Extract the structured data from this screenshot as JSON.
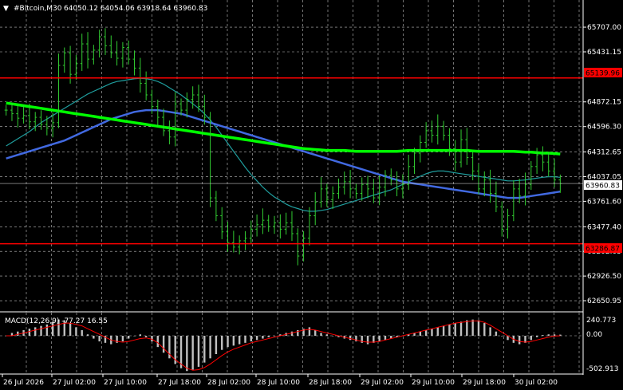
{
  "header": {
    "symbol": "#Bitcoin,M30",
    "ohlc": "64050.12 64054.06 63918.64 63960.83"
  },
  "price_axis": {
    "ticks": [
      "65707.00",
      "65431.15",
      "64872.15",
      "64596.30",
      "64312.65",
      "64037.05",
      "63761.60",
      "63477.40",
      "63202.05",
      "62926.50",
      "62650.95"
    ]
  },
  "levels": {
    "resistance": "65139.96",
    "support": "63286.87",
    "current": "63960.83"
  },
  "macd": {
    "label": "MACD(12,26,9) -77.27 16.55",
    "ticks": [
      "240.773",
      "0.00",
      "-502.913"
    ]
  },
  "time_axis": {
    "labels": [
      "26 Jul 2026",
      "27 Jul 02:00",
      "27 Jul 10:00",
      "27 Jul 18:00",
      "28 Jul 02:00",
      "28 Jul 10:00",
      "28 Jul 18:00",
      "29 Jul 02:00",
      "29 Jul 10:00",
      "29 Jul 18:00",
      "30 Jul 02:00"
    ]
  },
  "colors": {
    "background": "#000000",
    "grid": "#c0c0c0",
    "candles": "#32cd32",
    "ma_fast": "#1f9e9e",
    "ma_mid": "#4169e1",
    "ma_slow": "#00ff00",
    "levels": "#ff0000",
    "macd_hist": "#c0c0c0",
    "macd_signal": "#ff0000"
  },
  "chart_data": {
    "type": "candlestick",
    "symbol": "#Bitcoin",
    "timeframe": "M30",
    "ylim": [
      62580,
      65850
    ],
    "macd_ylim": [
      -520,
      260
    ],
    "grid": true,
    "close": [
      64780,
      64740,
      64690,
      64720,
      64650,
      64700,
      64620,
      64580,
      64640,
      65280,
      65420,
      65180,
      65300,
      65520,
      65350,
      65450,
      65600,
      65500,
      65420,
      65360,
      65480,
      65350,
      65250,
      65080,
      64950,
      64820,
      64700,
      64550,
      64480,
      64850,
      64780,
      64900,
      64950,
      64820,
      64700,
      63800,
      63600,
      63420,
      63300,
      63250,
      63320,
      63350,
      63450,
      63500,
      63550,
      63480,
      63520,
      63450,
      63520,
      63400,
      63150,
      63350,
      63600,
      63750,
      63900,
      63780,
      63850,
      63920,
      63980,
      63900,
      63850,
      63950,
      63900,
      63800,
      63920,
      64050,
      64000,
      63900,
      63950,
      64150,
      64300,
      64420,
      64550,
      64500,
      64600,
      64500,
      64350,
      64200,
      64450,
      64250,
      64100,
      63900,
      64000,
      63850,
      63700,
      63450,
      63600,
      63900,
      63820,
      63950,
      64150,
      64280,
      64200,
      64100,
      64000,
      63960
    ],
    "ma_fast": [
      64380,
      64420,
      64460,
      64500,
      64540,
      64590,
      64640,
      64680,
      64720,
      64760,
      64800,
      64840,
      64880,
      64920,
      64960,
      64990,
      65020,
      65050,
      65080,
      65100,
      65110,
      65120,
      65130,
      65135,
      65130,
      65120,
      65100,
      65070,
      65030,
      64990,
      64950,
      64900,
      64850,
      64800,
      64740,
      64670,
      64590,
      64500,
      64410,
      64320,
      64230,
      64140,
      64060,
      63990,
      63920,
      63860,
      63810,
      63770,
      63730,
      63700,
      63680,
      63660,
      63650,
      63650,
      63660,
      63670,
      63690,
      63710,
      63730,
      63750,
      63770,
      63790,
      63810,
      63830,
      63850,
      63870,
      63890,
      63920,
      63950,
      63980,
      64010,
      64040,
      64070,
      64090,
      64100,
      64100,
      64090,
      64080,
      64070,
      64060,
      64050,
      64040,
      64030,
      64020,
      64010,
      64000,
      63990,
      63990,
      63995,
      64000,
      64010,
      64020,
      64030,
      64035,
      64035,
      64030
    ],
    "ma_mid": [
      64240,
      64260,
      64280,
      64300,
      64320,
      64340,
      64360,
      64380,
      64400,
      64420,
      64440,
      64470,
      64500,
      64530,
      64560,
      64590,
      64620,
      64650,
      64680,
      64700,
      64720,
      64740,
      64760,
      64770,
      64780,
      64780,
      64780,
      64770,
      64760,
      64750,
      64740,
      64720,
      64700,
      64680,
      64660,
      64640,
      64620,
      64600,
      64580,
      64560,
      64540,
      64520,
      64500,
      64480,
      64460,
      64440,
      64420,
      64400,
      64380,
      64360,
      64340,
      64320,
      64300,
      64280,
      64260,
      64240,
      64220,
      64200,
      64180,
      64160,
      64140,
      64120,
      64100,
      64080,
      64060,
      64040,
      64020,
      64000,
      63980,
      63970,
      63960,
      63950,
      63940,
      63930,
      63920,
      63910,
      63900,
      63890,
      63880,
      63870,
      63860,
      63850,
      63840,
      63830,
      63820,
      63810,
      63800,
      63800,
      63800,
      63810,
      63820,
      63830,
      63840,
      63850,
      63860,
      63870
    ],
    "ma_slow": [
      64860,
      64850,
      64840,
      64830,
      64820,
      64810,
      64800,
      64790,
      64780,
      64770,
      64760,
      64750,
      64740,
      64730,
      64720,
      64710,
      64700,
      64690,
      64680,
      64670,
      64660,
      64650,
      64640,
      64630,
      64620,
      64610,
      64600,
      64590,
      64580,
      64570,
      64560,
      64550,
      64540,
      64530,
      64520,
      64510,
      64500,
      64490,
      64480,
      64470,
      64460,
      64450,
      64440,
      64430,
      64420,
      64410,
      64400,
      64390,
      64380,
      64370,
      64360,
      64350,
      64345,
      64340,
      64335,
      64330,
      64330,
      64330,
      64330,
      64325,
      64320,
      64320,
      64320,
      64320,
      64320,
      64320,
      64320,
      64320,
      64325,
      64330,
      64330,
      64330,
      64330,
      64330,
      64330,
      64330,
      64330,
      64330,
      64330,
      64330,
      64325,
      64320,
      64320,
      64320,
      64320,
      64320,
      64320,
      64320,
      64315,
      64310,
      64310,
      64305,
      64300,
      64300,
      64295,
      64290
    ],
    "macd_hist": [
      0,
      40,
      60,
      80,
      100,
      120,
      140,
      160,
      200,
      230,
      220,
      180,
      120,
      80,
      20,
      -40,
      -80,
      -100,
      -120,
      -100,
      -80,
      -40,
      0,
      20,
      -20,
      -80,
      -160,
      -240,
      -320,
      -400,
      -460,
      -500,
      -480,
      -440,
      -380,
      -320,
      -260,
      -200,
      -160,
      -140,
      -120,
      -100,
      -80,
      -60,
      -40,
      -20,
      0,
      20,
      40,
      60,
      80,
      100,
      120,
      80,
      40,
      20,
      0,
      -20,
      -40,
      -60,
      -80,
      -100,
      -120,
      -100,
      -80,
      -60,
      -40,
      -20,
      0,
      20,
      40,
      60,
      80,
      100,
      120,
      140,
      160,
      180,
      200,
      220,
      230,
      220,
      180,
      120,
      60,
      0,
      -60,
      -100,
      -120,
      -100,
      -60,
      -20,
      10,
      20,
      20,
      16
    ],
    "macd_signal": [
      0,
      0,
      20,
      40,
      60,
      80,
      100,
      120,
      140,
      160,
      180,
      180,
      160,
      140,
      100,
      60,
      20,
      -20,
      -60,
      -80,
      -90,
      -80,
      -60,
      -40,
      -30,
      -50,
      -100,
      -180,
      -260,
      -340,
      -400,
      -460,
      -490,
      -480,
      -450,
      -400,
      -340,
      -280,
      -230,
      -190,
      -160,
      -130,
      -100,
      -80,
      -60,
      -40,
      -20,
      0,
      20,
      40,
      60,
      80,
      90,
      80,
      60,
      40,
      20,
      0,
      -20,
      -40,
      -60,
      -80,
      -90,
      -90,
      -80,
      -60,
      -40,
      -20,
      0,
      20,
      40,
      60,
      80,
      100,
      120,
      140,
      160,
      180,
      190,
      200,
      210,
      210,
      190,
      150,
      100,
      50,
      0,
      -50,
      -80,
      -90,
      -80,
      -60,
      -40,
      -20,
      -5,
      0
    ],
    "series": [
      {
        "name": "MACD",
        "values": "macd_hist"
      }
    ]
  }
}
